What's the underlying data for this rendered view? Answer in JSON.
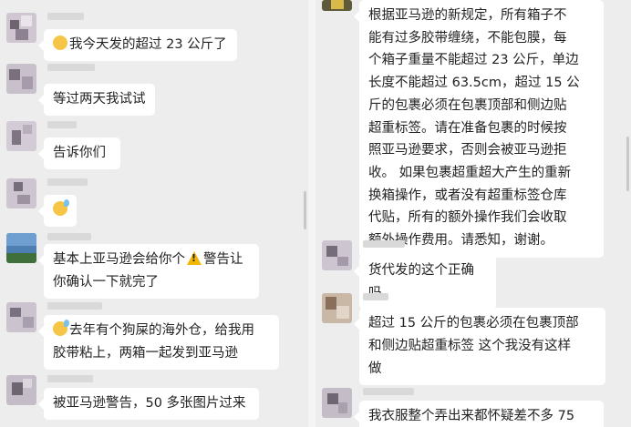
{
  "left_chat": {
    "messages": [
      {
        "text": "我今天发的超过 23 公斤了",
        "emoji": "smile-emoji"
      },
      {
        "text": "等过两天我试试"
      },
      {
        "text": "告诉你们"
      },
      {
        "text": "",
        "emoji": "sweat-smile-emoji"
      },
      {
        "text_before": "基本上亚马逊会给你个",
        "icon": "warning-icon",
        "text_after": "警告让\n你确认一下就完了"
      },
      {
        "text": "去年有个狗屎的海外仓，给我用\n胶带粘上，两箱一起发到亚马逊",
        "emoji": "sweat-smile-emoji"
      },
      {
        "text": "被亚马逊警告，50 多张图片过来"
      }
    ]
  },
  "right_chat": {
    "messages": [
      {
        "text": "根据亚马逊的新规定，所有箱子不\n能有过多胶带缠绕，不能包膜，每\n个箱子重量不能超过 23 公斤，单边\n长度不能超过 63.5cm，超过 15 公\n斤的包裹必须在包裹顶部和侧边贴\n超重标签。请在准备包裹的时候按\n照亚马逊要求，否则会被亚马逊拒\n收。 如果包裹超重超大产生的重新\n换箱操作，或者没有超重标签仓库\n代贴，所有的额外操作我们会收取\n额外操作费用。请悉知，谢谢。"
      },
      {
        "text": "货代发的这个正确吗"
      },
      {
        "text": "超过 15 公斤的包裹必须在包裹顶部\n和侧边贴超重标签 这个我没有这样\n做"
      },
      {
        "text": "我衣服整个弄出来都怀疑差不多 75"
      }
    ]
  },
  "colors": {
    "background": "#ededed",
    "bubble": "#ffffff",
    "text": "#222222"
  }
}
